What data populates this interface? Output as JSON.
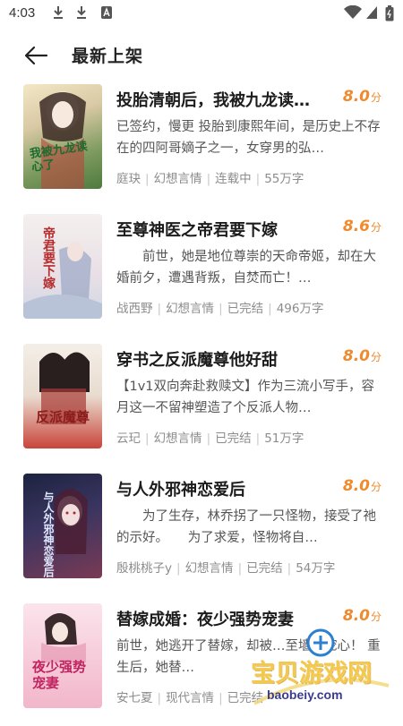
{
  "status_bar": {
    "time": "4:03",
    "icons": [
      "download-icon",
      "download-icon",
      "font-icon",
      "wifi-icon",
      "signal-icon",
      "battery-icon"
    ]
  },
  "header": {
    "back_icon": "arrow-left-icon",
    "title": "最新上架"
  },
  "colors": {
    "score": "#f08a2c",
    "meta": "#8c8c8c",
    "title": "#1c1c1c"
  },
  "books": [
    {
      "title": "投胎清朝后，我被九龙读…",
      "score": "8.0",
      "score_unit": "分",
      "desc": "已签约，慢更 投胎到康熙年间，是历史上不存在的四阿哥嫡子之一，女穿男的弘…",
      "author": "庭玦",
      "category": "幻想言情",
      "status": "连载中",
      "words": "55万字",
      "cover_text": "我被九龙读心了"
    },
    {
      "title": "至尊神医之帝君要下嫁",
      "score": "8.6",
      "score_unit": "分",
      "desc": "　　前世，她是地位尊崇的天命帝姬，却在大婚前夕，遭遇背叛，自焚而亡！…",
      "author": "战西野",
      "category": "幻想言情",
      "status": "已完结",
      "words": "496万字",
      "cover_text": "帝君要下嫁"
    },
    {
      "title": "穿书之反派魔尊他好甜",
      "score": "8.0",
      "score_unit": "分",
      "desc": "【1v1双向奔赴救赎文】作为三流小写手，容月这一不留神塑造了个反派人物…",
      "author": "云玘",
      "category": "幻想言情",
      "status": "已完结",
      "words": "51万字",
      "cover_text": "反派魔尊"
    },
    {
      "title": "与人外邪神恋爱后",
      "score": "8.0",
      "score_unit": "分",
      "desc": "　　为了生存，林乔拐了一只怪物，接受了祂的示好。　　为了求爱，怪物将自…",
      "author": "殷桃桃子y",
      "category": "幻想言情",
      "status": "已完结",
      "words": "54万字",
      "cover_text": "与人外邪神恋爱后"
    },
    {
      "title": "替嫁成婚：夜少强势宠妻",
      "score": "8.0",
      "score_unit": "分",
      "desc": "前世，她逃开了替嫁，却被…至墙角挖心！ 重生后，她替…",
      "author": "安七夏",
      "category": "现代言情",
      "status": "已完结",
      "words": "",
      "cover_text": "夜少强势宠妻"
    }
  ],
  "watermark": {
    "line1": "宝贝游戏网",
    "line2": "baobeiy.com"
  }
}
